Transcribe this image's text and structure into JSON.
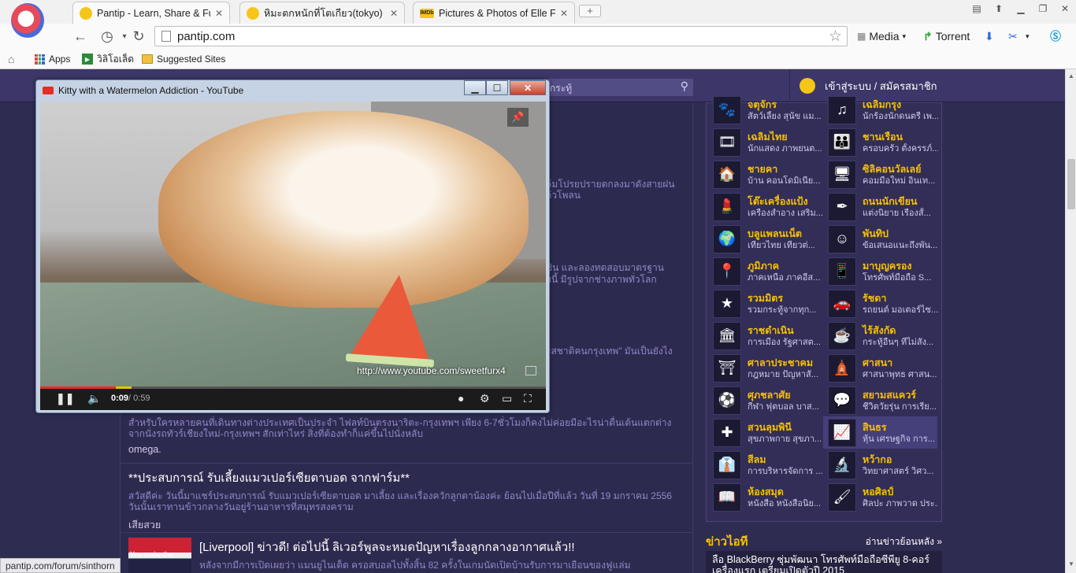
{
  "browser": {
    "tabs": [
      {
        "title": "Pantip - Learn, Share & Fun",
        "icon": "smiley-favicon"
      },
      {
        "title": "หิมะตกหนักที่โตเกียว(tokyo) -",
        "icon": "smiley-favicon"
      },
      {
        "title": "Pictures & Photos of Elle Fa",
        "icon": "imdb-favicon",
        "badge": "IMDb"
      }
    ],
    "new_tab_symbol": "+",
    "address": "pantip.com",
    "extensions": [
      {
        "label": "Media",
        "icon": "media-icon"
      },
      {
        "label": "Torrent",
        "icon": "torrent-icon"
      }
    ],
    "bookmarks": [
      {
        "label": "Apps"
      },
      {
        "label": "วิลิโอเล็ด"
      },
      {
        "label": "Suggested Sites"
      }
    ]
  },
  "site": {
    "search_placeholder": "กระทู้",
    "login_label": "เข้าสู่ระบบ / สมัครสมาชิก"
  },
  "video": {
    "window_title": "Kitty with a Watermelon Addiction - YouTube",
    "watermark": "http://www.youtube.com/sweetfurx4",
    "time_current": "0:09",
    "time_total": " / 0:59",
    "progress_fraction": 0.15,
    "buffer_fraction": 0.18
  },
  "posts": [
    {
      "title": "",
      "excerpt": "สำหรับใครหลายคนที่เดินทางต่างประเทศเป็นประจำ ไฟลท์บินตรงนาริตะ-กรุงเทพฯ เพียง 6-7ชั่วโมงก็คงไม่ค่อยมีอะไรน่าตื่นเต้นแตกต่าง จากนั่งรถทัวร์เชียงใหม่-กรุงเทพฯ สักเท่าไหร่ สิ่งที่ต้องทำก็แค่ขึ้นไปนั่งหลับ",
      "author": "omega."
    },
    {
      "title": "**ประสบการณ์ รับเลี้ยงแมวเปอร์เซียตาบอด จากฟาร์ม**",
      "excerpt": "สวัสดีค่ะ วันนี้มาแชร์ประสบการณ์ รับแมวเปอร์เซียตาบอด มาเลี้ยง และเรื่องควักลูกตาน้องค่ะ ย้อนไปเมื่อปีที่แล้ว วันที่ 19 มกราคม 2556 วันนั้นเราทานข้าวกลางวันอยู่ร้านอาหารที่สมุทรสงคราม",
      "author": "เสียสวย"
    },
    {
      "title": "[Liverpool] ข่าวดี! ต่อไปนี้ ลิเวอร์พูลจะหมดปัญหาเรื่องลูกกลางอากาศแล้ว!!",
      "excerpt": "หลังจากมีการเปิดเผยว่า แมนยูไนเต็ด ครอสบอลไปทั้งสิ้น 82 ครั้งในเกมนัดเปิดบ้านรับการมาเยือนของฟูแล่ม",
      "thumb_caption": "You make the"
    }
  ],
  "background_snippets": [
    "ล้มโปรยปรายตกลงมาดังสายฝน",
    "ก้วโพลน",
    "ชิน และลองทดสอบมาตรฐาน",
    "ยนี้ มีรูปจากช่างภาพทั่วโลก",
    "รสชาดิคนกรุงเทพ\" มันเป็นยังไง"
  ],
  "categories": [
    {
      "name": "จตุจักร",
      "desc": "สัตว์เลี้ยง สุนัข แม...",
      "icon": "pet-icon",
      "glyph": "🐾"
    },
    {
      "name": "เฉลิมกรุง",
      "desc": "นักร้องนักดนตรี เพ...",
      "icon": "music-note-icon",
      "glyph": "♫"
    },
    {
      "name": "เฉลิมไทย",
      "desc": "นักแสดง ภาพยนต...",
      "icon": "film-icon",
      "glyph": "🎞"
    },
    {
      "name": "ชานเรือน",
      "desc": "ครอบครัว ตั้งครรภ์...",
      "icon": "family-icon",
      "glyph": "👪"
    },
    {
      "name": "ชายคา",
      "desc": "บ้าน คอนโดมิเนีย...",
      "icon": "house-icon",
      "glyph": "🏠"
    },
    {
      "name": "ซิลิคอนวัลเลย์",
      "desc": "คอมมือใหม่ อินเท...",
      "icon": "computer-icon",
      "glyph": "🖥"
    },
    {
      "name": "โต๊ะเครื่องแป้ง",
      "desc": "เครื่องสำอาง เสริม...",
      "icon": "cosmetics-icon",
      "glyph": "💄"
    },
    {
      "name": "ถนนนักเขียน",
      "desc": "แต่งนิยาย เรื่องสั้...",
      "icon": "pen-icon",
      "glyph": "✒"
    },
    {
      "name": "บลูแพลนเน็ต",
      "desc": "เที่ยวไทย เที่ยวต่...",
      "icon": "travel-icon",
      "glyph": "🌍"
    },
    {
      "name": "พันทิป",
      "desc": "ข้อเสนอแนะถึงพัน...",
      "icon": "smiley-icon",
      "glyph": "☺"
    },
    {
      "name": "ภูมิภาค",
      "desc": "ภาคเหนือ ภาคอีส...",
      "icon": "thailand-map-icon",
      "glyph": "📍"
    },
    {
      "name": "มาบุญครอง",
      "desc": "โทรศัพท์มือถือ S...",
      "icon": "mobile-phone-icon",
      "glyph": "📱"
    },
    {
      "name": "รวมมิตร",
      "desc": "รวมกระทู้จากทุก...",
      "icon": "stars-icon",
      "glyph": "★"
    },
    {
      "name": "รัชดา",
      "desc": "รถยนต์ มอเตอร์ไซ...",
      "icon": "car-icon",
      "glyph": "🚗"
    },
    {
      "name": "ราชดำเนิน",
      "desc": "การเมือง รัฐศาสต...",
      "icon": "monument-icon",
      "glyph": "🏛"
    },
    {
      "name": "ไร้สังกัด",
      "desc": "กระทู้อื่นๆ ที่ไม่สัง...",
      "icon": "coffee-cup-icon",
      "glyph": "☕"
    },
    {
      "name": "ศาลาประชาคม",
      "desc": "กฎหมาย ปัญหาสั...",
      "icon": "pavilion-icon",
      "glyph": "⛩"
    },
    {
      "name": "ศาสนา",
      "desc": "ศาสนาพุทธ ศาสน...",
      "icon": "temple-icon",
      "glyph": "🛕"
    },
    {
      "name": "ศุภชลาศัย",
      "desc": "กีฬา ฟุตบอล บาส...",
      "icon": "sports-icon",
      "glyph": "⚽"
    },
    {
      "name": "สยามสแควร์",
      "desc": "ชีวิตวัยรุ่น การเรีย...",
      "icon": "chat-bubble-icon",
      "glyph": "💬"
    },
    {
      "name": "สวนลุมพินี",
      "desc": "สุขภาพกาย สุขภา...",
      "icon": "health-cross-icon",
      "glyph": "✚"
    },
    {
      "name": "สินธร",
      "desc": "หุ้น เศรษฐกิจ การ...",
      "icon": "stock-chart-icon",
      "glyph": "📈"
    },
    {
      "name": "สีลม",
      "desc": "การบริหารจัดการ ...",
      "icon": "businessman-icon",
      "glyph": "👔"
    },
    {
      "name": "หว้ากอ",
      "desc": "วิทยาศาสตร์ วิศว...",
      "icon": "science-icon",
      "glyph": "🔬"
    },
    {
      "name": "ห้องสมุด",
      "desc": "หนังสือ หนังสือนิย...",
      "icon": "book-icon",
      "glyph": "📖"
    },
    {
      "name": "หอศิลป์",
      "desc": "ศิลปะ ภาพวาด ประ...",
      "icon": "art-brush-icon",
      "glyph": "🖌"
    }
  ],
  "selected_category": "สินธร",
  "news": {
    "heading": "ข่าวไอที",
    "more_link": "อ่านข่าวย้อนหลัง »",
    "item": "ลือ BlackBerry ซุ่มพัฒนา โทรศัพท์มือถือซีพียู 8-คอร์ เครื่องแรก เตรียมเปิดตัวปี 2015"
  },
  "status_url": "pantip.com/forum/sinthorn"
}
